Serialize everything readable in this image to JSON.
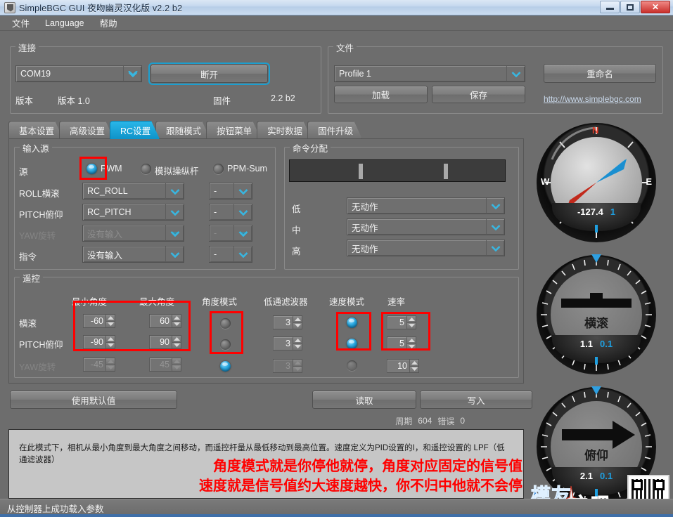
{
  "window": {
    "title": "SimpleBGC GUI 夜吻幽灵汉化版 v2.2 b2",
    "icon": "java-app-icon",
    "minimize": "minimize-icon",
    "maximize": "maximize-icon",
    "close": "✕"
  },
  "menu": {
    "items": [
      {
        "label": "文件",
        "name": "menu-file"
      },
      {
        "label": "Language",
        "name": "menu-language"
      },
      {
        "label": "帮助",
        "name": "menu-help"
      }
    ]
  },
  "connection": {
    "legend": "连接",
    "port_value": "COM19",
    "disconnect_label": "断开",
    "version_label": "版本",
    "version_value": "版本 1.0",
    "firmware_label": "固件",
    "firmware_value": "2.2 b2"
  },
  "file": {
    "legend": "文件",
    "profile_value": "Profile 1",
    "rename_label": "重命名",
    "load_label": "加载",
    "save_label": "保存",
    "site_url": "http://www.simplebgc.com"
  },
  "tabs": [
    {
      "label": "基本设置",
      "name": "tab-basic",
      "active": false
    },
    {
      "label": "高级设置",
      "name": "tab-advanced",
      "active": false
    },
    {
      "label": "RC设置",
      "name": "tab-rc",
      "active": true
    },
    {
      "label": "跟随模式",
      "name": "tab-follow",
      "active": false
    },
    {
      "label": "按钮菜单",
      "name": "tab-button-menu",
      "active": false
    },
    {
      "label": "实时数据",
      "name": "tab-realtime",
      "active": false
    },
    {
      "label": "固件升级",
      "name": "tab-firmware",
      "active": false
    }
  ],
  "input_source": {
    "legend": "输入源",
    "source_label": "源",
    "radios": [
      {
        "label": "PWM",
        "selected": true
      },
      {
        "label": "模拟操纵杆",
        "selected": false
      },
      {
        "label": "PPM-Sum",
        "selected": false
      }
    ],
    "rows": [
      {
        "label": "ROLL横滚",
        "value": "RC_ROLL",
        "aux": "-",
        "disabled": false
      },
      {
        "label": "PITCH俯仰",
        "value": "RC_PITCH",
        "aux": "-",
        "disabled": false
      },
      {
        "label": "YAW旋转",
        "value": "没有输入",
        "aux": "-",
        "disabled": true
      },
      {
        "label": "指令",
        "value": "没有输入",
        "aux": "-",
        "disabled": false
      }
    ]
  },
  "command_assign": {
    "legend": "命令分配",
    "rows": [
      {
        "label": "低",
        "value": "无动作"
      },
      {
        "label": "中",
        "value": "无动作"
      },
      {
        "label": "高",
        "value": "无动作"
      }
    ]
  },
  "remote": {
    "legend": "遥控",
    "headers": {
      "min_angle": "最小角度",
      "max_angle": "最大角度",
      "angle_mode": "角度模式",
      "lpf": "低通滤波器",
      "speed_mode": "速度模式",
      "rate": "速率"
    },
    "rows": [
      {
        "label": "横滚",
        "min": "-60",
        "max": "60",
        "angle_mode": false,
        "lpf": "3",
        "speed_mode": true,
        "rate": "5",
        "disabled": false
      },
      {
        "label": "PITCH俯仰",
        "min": "-90",
        "max": "90",
        "angle_mode": false,
        "lpf": "3",
        "speed_mode": true,
        "rate": "5",
        "disabled": false
      },
      {
        "label": "YAW旋转",
        "min": "-45",
        "max": "45",
        "angle_mode": true,
        "lpf": "3",
        "speed_mode": false,
        "rate": "10",
        "disabled": true
      }
    ]
  },
  "actions": {
    "defaults_label": "使用默认值",
    "read_label": "读取",
    "write_label": "写入"
  },
  "cycle": {
    "cycle_label": "周期",
    "cycle_value": "604",
    "error_label": "错误",
    "error_value": "0"
  },
  "console": {
    "info_text": "在此模式下，相机从最小角度到最大角度之间移动，而遥控杆量从最低移动到最高位置。速度定义为PID设置的I，和遥控设置的 LPF（低通滤波器）",
    "red_line_1": "角度模式就是你停他就停，角度对应固定的信号值",
    "red_line_2": "速度就是信号值约大速度越快，你不归中他就不会停"
  },
  "statusbar": {
    "text": "从控制器上成功载入参数"
  },
  "gauges": [
    {
      "name": "heading-compass",
      "type": "compass",
      "cardinals": {
        "n": "N",
        "w": "W",
        "e": "E"
      },
      "value_white": "-127.4",
      "value_blue": "1"
    },
    {
      "name": "roll-gauge",
      "type": "roll",
      "title": "横滚",
      "value_white": "1.1",
      "value_blue": "0.1"
    },
    {
      "name": "pitch-gauge",
      "type": "pitch",
      "title": "俯仰",
      "value_white": "2.1",
      "value_blue": "0.1"
    }
  ],
  "watermark": {
    "line1": "模友",
    "line2": "之吧",
    "url": "http://www.mo-fi.com"
  },
  "colors": {
    "accent": "#1b9fd0",
    "annotation": "#ff0000",
    "panel": "#6d6d6d",
    "text": "#f0f0f0"
  }
}
